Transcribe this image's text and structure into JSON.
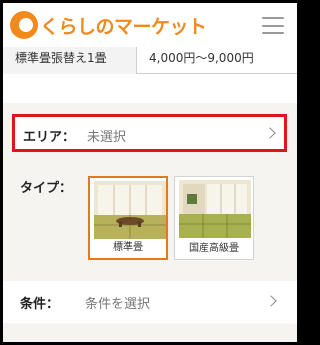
{
  "header": {
    "logo_text": "くらしのマーケット"
  },
  "price_table": {
    "label": "標準畳張替え1畳",
    "value": "4,000円〜9,000円"
  },
  "filters": {
    "area": {
      "label": "エリア：",
      "value": "未選択"
    },
    "type": {
      "label": "タイプ：",
      "options": [
        {
          "label": "標準畳",
          "selected": true
        },
        {
          "label": "国産高級畳",
          "selected": false
        }
      ]
    },
    "condition": {
      "label": "条件：",
      "value": "条件を選択"
    }
  },
  "colors": {
    "brand": "#f08a1c",
    "highlight": "#e0141e",
    "selected_border": "#e07a1c"
  }
}
